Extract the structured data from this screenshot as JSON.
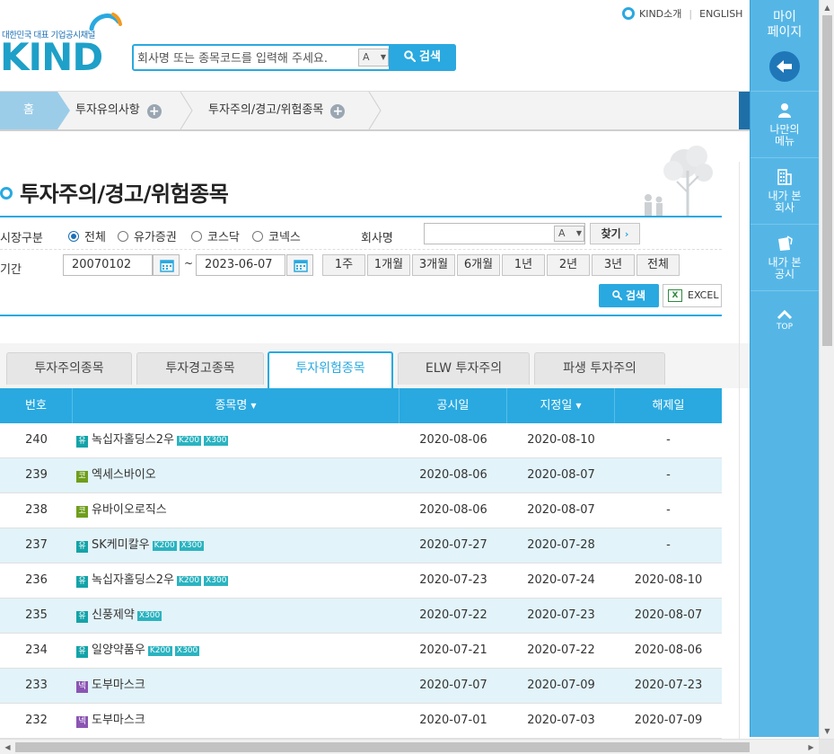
{
  "header": {
    "tagline": "대한민국 대표 기업공시채널",
    "logo_text": "KIND",
    "search_placeholder": "회사명 또는 종목코드를 입력해 주세요.",
    "lang_toggle": "A",
    "search_button": "검색",
    "top_links": [
      "KIND소개",
      "ENGLISH"
    ]
  },
  "breadcrumb": [
    "홈",
    "투자유의사항",
    "투자주의/경고/위험종목"
  ],
  "page_title": "투자주의/경고/위험종목",
  "filter": {
    "market_label": "시장구분",
    "market_options": [
      "전체",
      "유가증권",
      "코스닥",
      "코넥스"
    ],
    "market_selected": "전체",
    "company_label": "회사명",
    "company_lang": "A",
    "find_button": "찾기",
    "period_label": "기간",
    "date_from": "20070102",
    "date_to": "2023-06-07",
    "tilde": "~",
    "period_buttons": [
      "1주",
      "1개월",
      "3개월",
      "6개월",
      "1년",
      "2년",
      "3년",
      "전체"
    ],
    "search_button": "검색",
    "excel_button": "EXCEL",
    "excel_icon": "X"
  },
  "tabs": [
    "투자주의종목",
    "투자경고종목",
    "투자위험종목",
    "ELW 투자주의",
    "파생 투자주의"
  ],
  "active_tab": "투자위험종목",
  "table": {
    "headers": [
      "번호",
      "종목명",
      "공시일",
      "지정일",
      "해제일"
    ],
    "rows": [
      {
        "no": "240",
        "market": "유",
        "name": "녹십자홀딩스2우",
        "badges": [
          "K200",
          "X300"
        ],
        "disclosure": "2020-08-06",
        "designated": "2020-08-10",
        "released": "-"
      },
      {
        "no": "239",
        "market": "코",
        "name": "엑세스바이오",
        "badges": [],
        "disclosure": "2020-08-06",
        "designated": "2020-08-07",
        "released": "-"
      },
      {
        "no": "238",
        "market": "코",
        "name": "유바이오로직스",
        "badges": [],
        "disclosure": "2020-08-06",
        "designated": "2020-08-07",
        "released": "-"
      },
      {
        "no": "237",
        "market": "유",
        "name": "SK케미칼우",
        "badges": [
          "K200",
          "X300"
        ],
        "disclosure": "2020-07-27",
        "designated": "2020-07-28",
        "released": "-"
      },
      {
        "no": "236",
        "market": "유",
        "name": "녹십자홀딩스2우",
        "badges": [
          "K200",
          "X300"
        ],
        "disclosure": "2020-07-23",
        "designated": "2020-07-24",
        "released": "2020-08-10"
      },
      {
        "no": "235",
        "market": "유",
        "name": "신풍제약",
        "badges": [
          "X300"
        ],
        "disclosure": "2020-07-22",
        "designated": "2020-07-23",
        "released": "2020-08-07"
      },
      {
        "no": "234",
        "market": "유",
        "name": "일양약품우",
        "badges": [
          "K200",
          "X300"
        ],
        "disclosure": "2020-07-21",
        "designated": "2020-07-22",
        "released": "2020-08-06"
      },
      {
        "no": "233",
        "market": "넥",
        "name": "도부마스크",
        "badges": [],
        "disclosure": "2020-07-07",
        "designated": "2020-07-09",
        "released": "2020-07-23"
      },
      {
        "no": "232",
        "market": "넥",
        "name": "도부마스크",
        "badges": [],
        "disclosure": "2020-07-01",
        "designated": "2020-07-03",
        "released": "2020-07-09"
      }
    ]
  },
  "sidebar": {
    "mypage": "마이\n페이지",
    "items": [
      "나만의\n메뉴",
      "내가 본\n회사",
      "내가 본\n공시"
    ],
    "top": "TOP"
  },
  "colors": {
    "accent": "#29a9e0",
    "sidebar": "#55b6e6",
    "alt_row": "#e2f3f9",
    "market_yu": "#13a3a8",
    "market_ko": "#6f9e1c",
    "market_ne": "#8b55b3"
  },
  "icons": [
    "kind-icon",
    "search-icon",
    "calendar-icon",
    "excel-icon",
    "plus-icon",
    "arrow-left-icon",
    "person-icon",
    "building-icon",
    "document-icon",
    "chevron-up-icon",
    "tree-people-icon"
  ]
}
